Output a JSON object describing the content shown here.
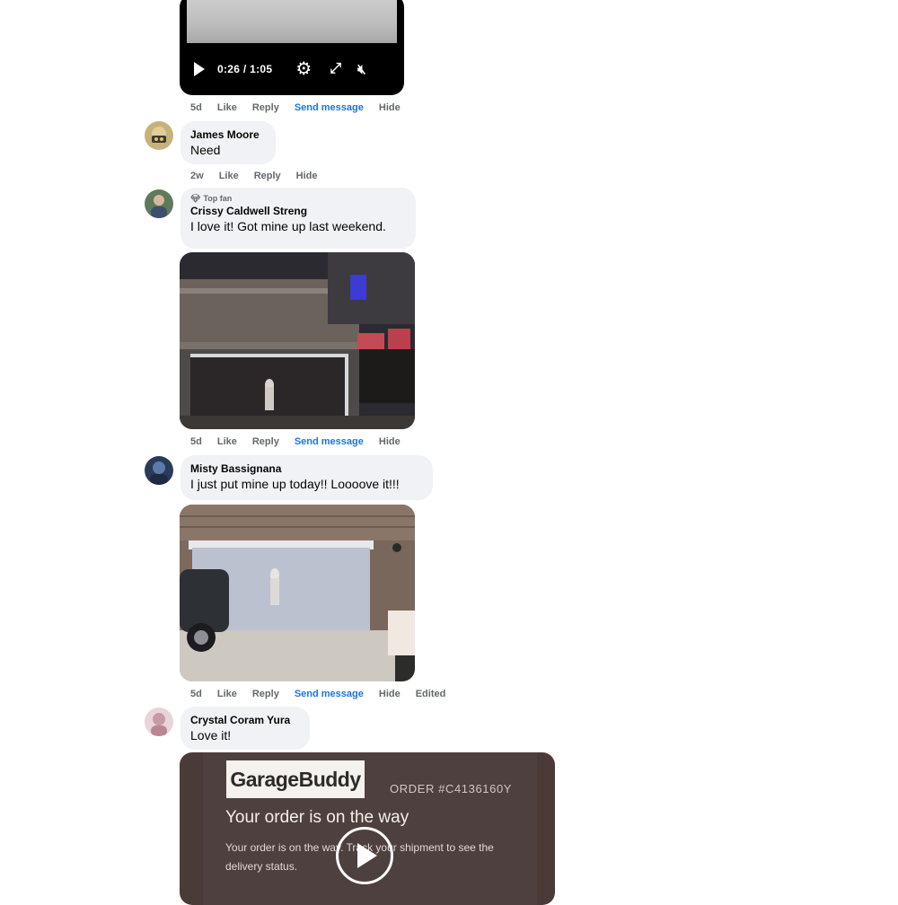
{
  "video": {
    "time": "0:26 / 1:05",
    "actions": {
      "age": "5d",
      "like": "Like",
      "reply": "Reply",
      "send": "Send message",
      "hide": "Hide"
    }
  },
  "comments": [
    {
      "author": "James Moore",
      "text": "Need",
      "actions": {
        "age": "2w",
        "like": "Like",
        "reply": "Reply",
        "hide": "Hide"
      }
    },
    {
      "badge": "Top fan",
      "author": "Crissy Caldwell Streng",
      "text": "I love it! Got mine up last weekend.",
      "actions": {
        "age": "5d",
        "like": "Like",
        "reply": "Reply",
        "send": "Send message",
        "hide": "Hide"
      }
    },
    {
      "author": "Misty Bassignana",
      "text": "I just put mine up today!! Loooove it!!!",
      "actions": {
        "age": "5d",
        "like": "Like",
        "reply": "Reply",
        "send": "Send message",
        "hide": "Hide",
        "edited": "Edited"
      }
    },
    {
      "author": "Crystal Coram Yura",
      "text": "Love it!"
    }
  ],
  "order_card": {
    "logo": "GarageBuddy",
    "order_number": "ORDER #C4136160Y",
    "title": "Your order is on the way",
    "body": "Your order is on the way. Track your shipment to see the delivery status."
  },
  "colors": {
    "bubble": "#f0f2f5",
    "link": "#1b74e4",
    "meta": "#65676b",
    "order_bg": "#4a3b39"
  }
}
